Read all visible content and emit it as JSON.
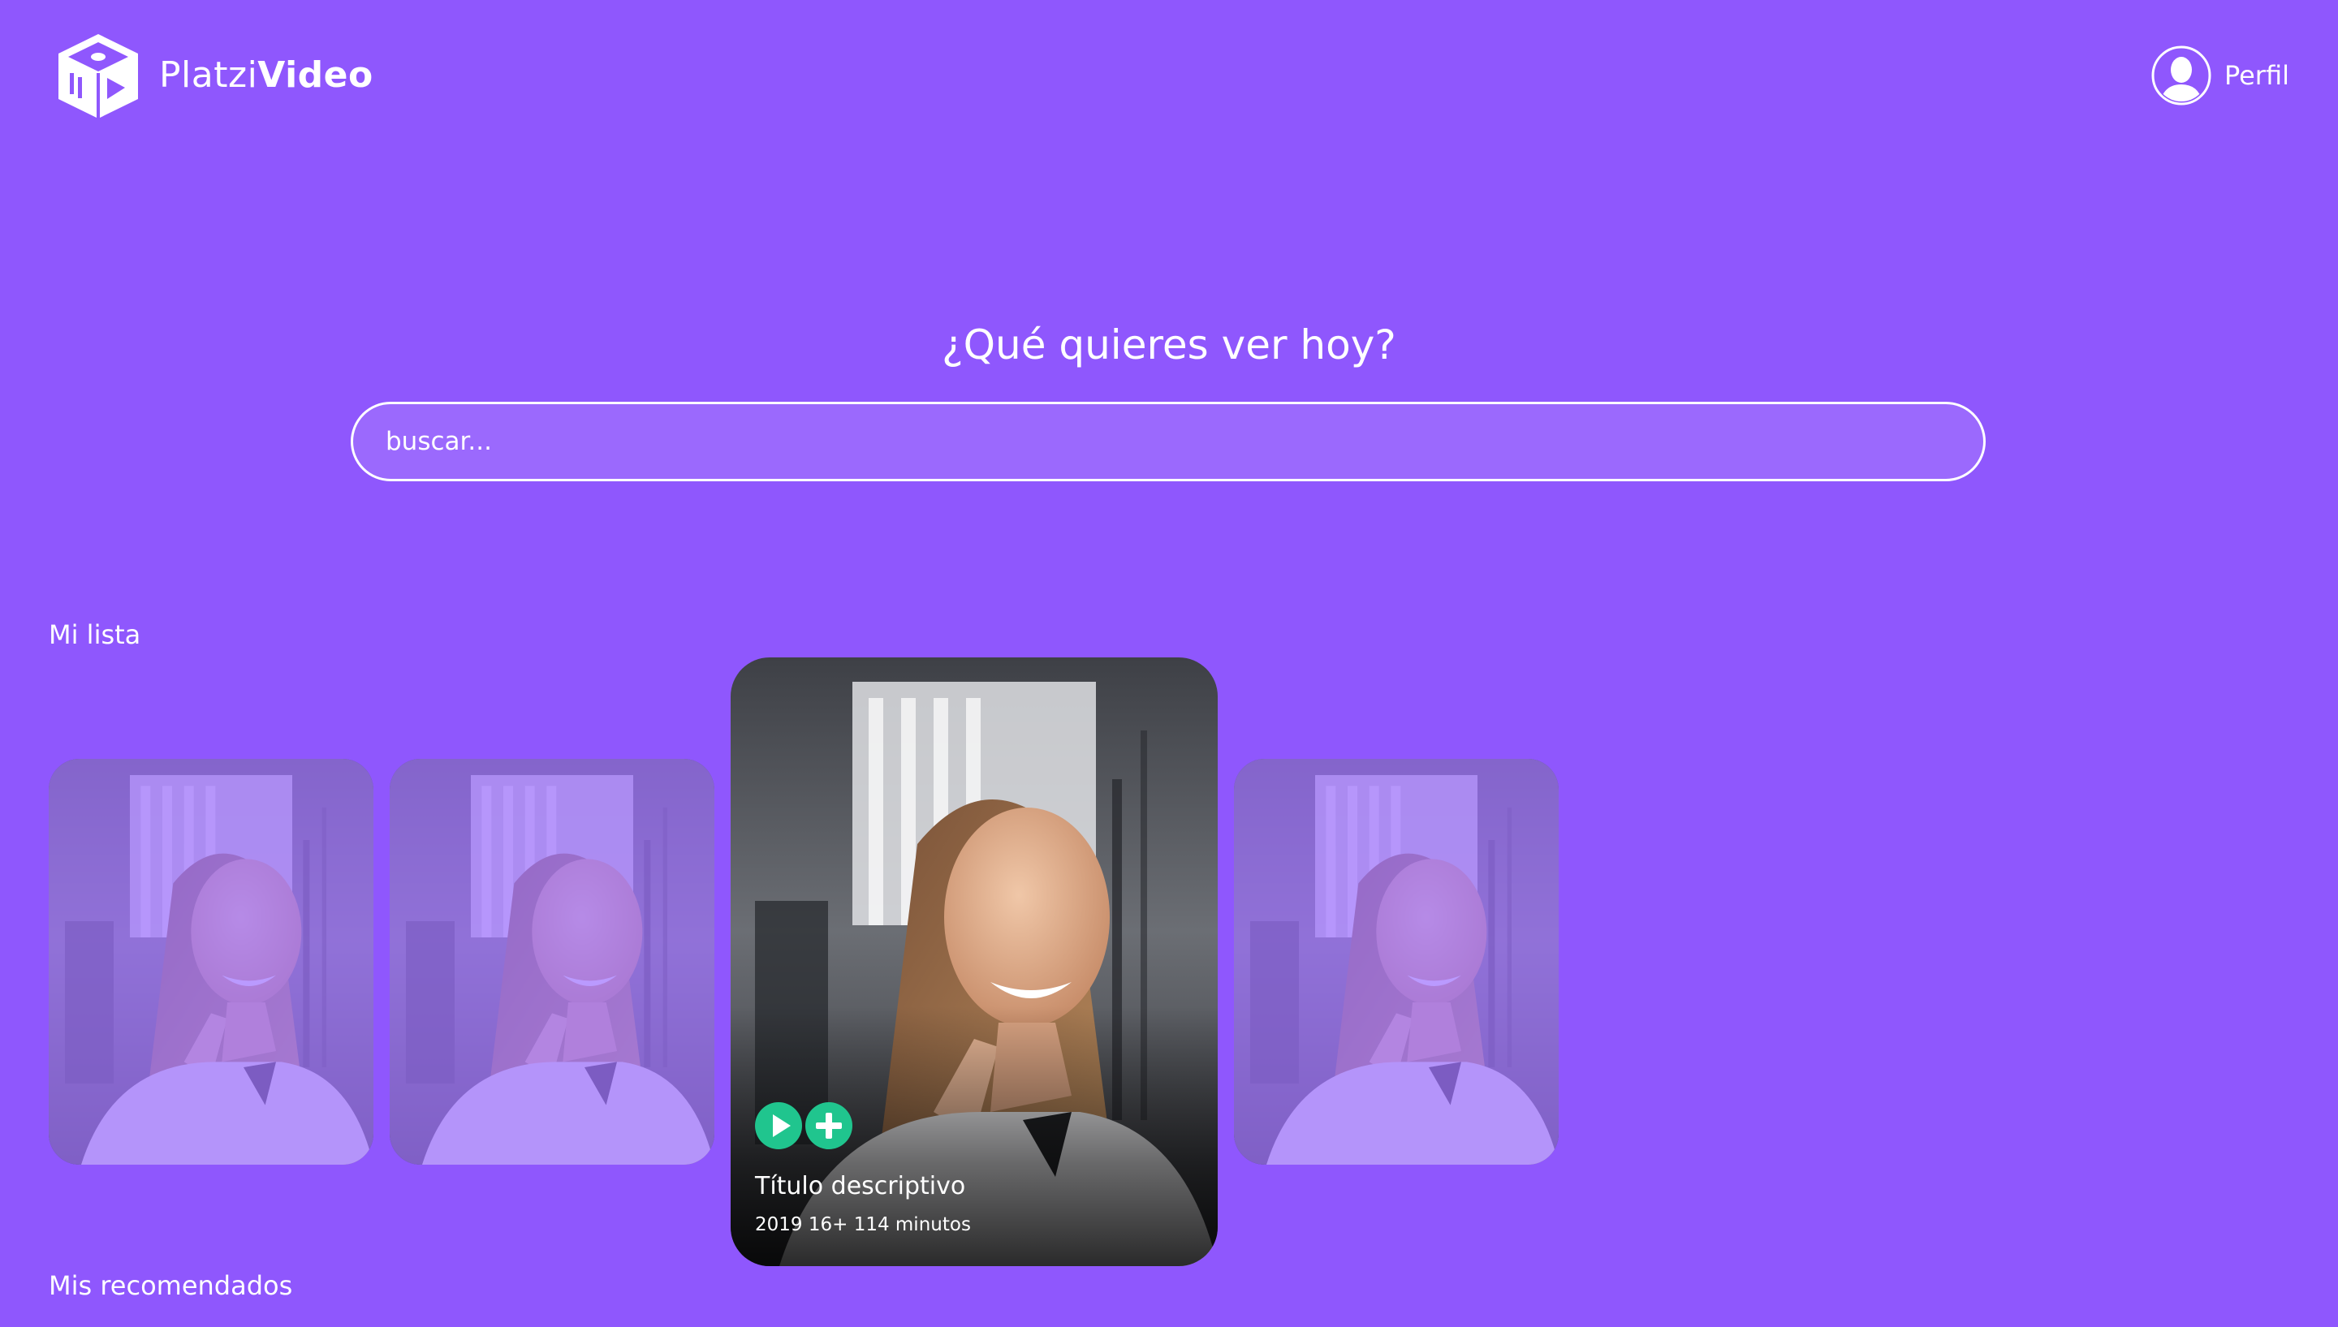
{
  "brand": {
    "name_light": "Platzi",
    "name_bold": "Video",
    "logo_icon": "platzivideo-cube-logo"
  },
  "header": {
    "profile_label": "Perfil",
    "profile_icon": "user-avatar-icon"
  },
  "hero": {
    "title": "¿Qué quieres ver hoy?",
    "search_placeholder": "buscar..."
  },
  "sections": {
    "my_list": "Mi lista",
    "recommended": "Mis recomendados"
  },
  "featured_card": {
    "title": "Título descriptivo",
    "meta": "2019 16+ 114 minutos",
    "actions": [
      "play-icon",
      "plus-icon"
    ]
  },
  "colors": {
    "background": "#8f57fd",
    "search_fill": "#9b69fd",
    "action_green": "#20c58e",
    "text": "#ffffff"
  }
}
